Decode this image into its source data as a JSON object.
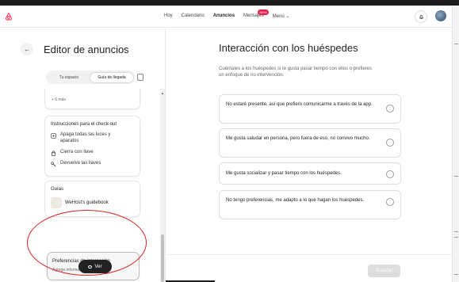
{
  "header": {
    "nav": [
      {
        "label": "Hoy"
      },
      {
        "label": "Calendario"
      },
      {
        "label": "Anuncios",
        "active": true
      },
      {
        "label": "Mensajes"
      },
      {
        "label": "Menú ⌄"
      }
    ],
    "messages_badge": "NEW",
    "icons": [
      "airbnb-logo-icon",
      "bell-icon",
      "avatar"
    ],
    "brand_color": "#ff385c"
  },
  "left": {
    "title": "Editor de anuncios",
    "tabs": [
      "Tu espacio",
      "Guía de llegada"
    ],
    "card_top": {
      "more": "+ 6 más"
    },
    "checkout": {
      "title": "Instrucciones para el check-out",
      "items": [
        "Apaga todas las luces y aparatos",
        "Cierra con llave",
        "Devuelve las llaves"
      ]
    },
    "guides": {
      "title": "Guías",
      "item": "WeHost's guidebook"
    },
    "interaction": {
      "title": "Preferencias de interacción",
      "subtitle": "Agrega información"
    },
    "view_button": "Ver"
  },
  "right": {
    "title": "Interacción con los huéspedes",
    "subtitle": "Cuéntales a los huéspedes si te gusta pasar tiempo con ellos o prefieres un enfoque de no intervención.",
    "options": [
      "No estaré presente, así que prefiero comunicarme a través de la app.",
      "Me gusta saludar en persona, pero fuera de eso, no convivo mucho.",
      "Me gusta socializar y pasar tiempo con los huéspedes.",
      "No tengo preferencias, me adapto a lo que hagan los huéspedes."
    ],
    "save": "Guardar"
  }
}
